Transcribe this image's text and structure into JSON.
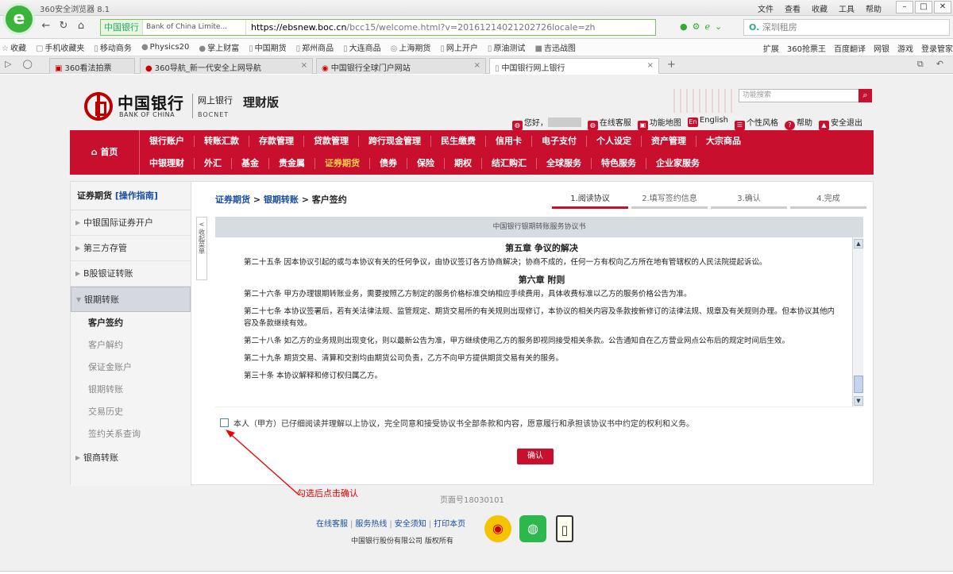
{
  "browser": {
    "title": "360安全浏览器 8.1",
    "menu": [
      "文件",
      "查看",
      "收藏",
      "工具",
      "帮助"
    ],
    "url_site": "中国银行",
    "url_tab_title": "Bank of China Limite...",
    "url_domain": "https://ebsnew.boc.cn",
    "url_path": "/bcc15/welcome.html?v=20161214021202726locale=zh",
    "search_text": "深圳租房",
    "bookmarks": [
      "收藏",
      "手机收藏夹",
      "移动商务",
      "Physics20",
      "掌上财富",
      "中国期货",
      "郑州商品",
      "大连商品",
      "上海期货",
      "网上开户",
      "原油测试",
      "吉迅战图"
    ],
    "bookmarks_right": [
      "扩展",
      "360抢票王",
      "百度翻译",
      "网银",
      "游戏",
      "登录管家"
    ],
    "tabs": [
      {
        "label": "360看法拍票"
      },
      {
        "label": "360导航_新一代安全上网导航"
      },
      {
        "label": "中国银行全球门户网站"
      },
      {
        "label": "中国银行网上银行"
      }
    ]
  },
  "header": {
    "bank_cn": "中国银行",
    "bank_en": "BANK OF CHINA",
    "online_bank": "网上银行",
    "bocnet": "BOCNET",
    "product": "理财版",
    "search_placeholder": "功能搜索",
    "greeting": "您好，",
    "links": [
      "在线客服",
      "功能地图",
      "English",
      "个性风格",
      "帮助",
      "安全退出"
    ]
  },
  "nav": {
    "home": "首页",
    "row1": [
      "银行账户",
      "转账汇款",
      "存款管理",
      "贷款管理",
      "跨行现金管理",
      "民生缴费",
      "信用卡",
      "电子支付",
      "个人设定",
      "资产管理",
      "大宗商品"
    ],
    "row2": [
      "中银理财",
      "外汇",
      "基金",
      "贵金属",
      "证券期货",
      "债券",
      "保险",
      "期权",
      "结汇购汇",
      "全球服务",
      "特色服务",
      "企业家服务"
    ],
    "active": "证券期货"
  },
  "sidebar": {
    "title": "证券期货",
    "guide": "[操作指南]",
    "items": [
      "中银国际证券开户",
      "第三方存管",
      "B股银证转账",
      "银期转账"
    ],
    "sub": [
      "客户签约",
      "客户解约",
      "保证金账户",
      "银期转账",
      "交易历史",
      "签约关系查询"
    ],
    "last": "银商转账",
    "collapse": "收起菜单"
  },
  "main": {
    "crumb1": "证券期货",
    "crumb2": "银期转账",
    "crumb3": "客户签约",
    "steps": [
      "1.阅读协议",
      "2.填写签约信息",
      "3.确认",
      "4.完成"
    ],
    "agreement_title": "中国银行银期转账服务协议书",
    "chapter5": "第五章 争议的解决",
    "p25": "第二十五条 因本协议引起的或与本协议有关的任何争议，由协议签订各方协商解决；协商不成的，任何一方有权向乙方所在地有管辖权的人民法院提起诉讼。",
    "chapter6": "第六章 附则",
    "p26": "第二十六条 甲方办理银期转账业务，需要按照乙方制定的服务价格标准交纳相应手续费用，具体收费标准以乙方的服务价格公告为准。",
    "p27": "第二十七条 本协议签署后，若有关法律法规、监管规定、期货交易所的有关规则出现修订，本协议的相关内容及条款按新修订的法律法规、规章及有关规则办理。但本协议其他内容及条款继续有效。",
    "p28": "第二十八条 如乙方的业务规则出现变化，则以最新公告为准，甲方继续使用乙方的服务即视同接受相关条款。公告通知自在乙方营业网点公布后的规定时间后生效。",
    "p29": "第二十九条 期货交易、清算和交割均由期货公司负责，乙方不向甲方提供期货交易有关的服务。",
    "p30": "第三十条 本协议解释和修订权归属乙方。",
    "agree_text": "本人（甲方）已仔细阅读并理解以上协议，完全同意和接受协议书全部条款和内容，愿意履行和承担该协议书中约定的权利和义务。",
    "confirm": "确认"
  },
  "annotation": "勾选后点击确认",
  "footer": {
    "page_no": "页面号18030101",
    "links": [
      "在线客服",
      "服务热线",
      "安全须知",
      "打印本页"
    ],
    "copyright": "中国银行股份有限公司  版权所有"
  }
}
